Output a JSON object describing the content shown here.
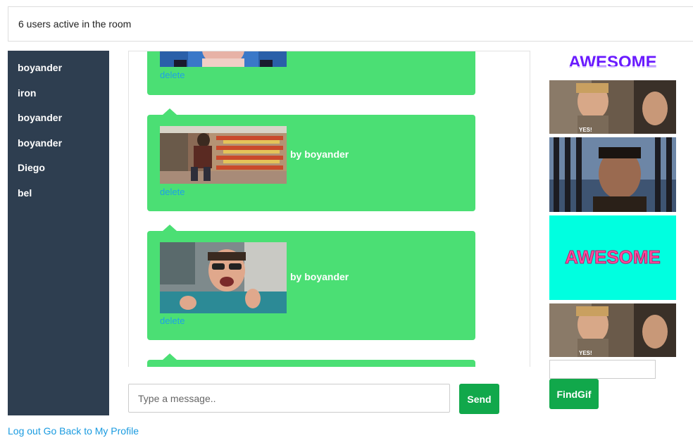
{
  "header": {
    "status_text": "6 users active in the room"
  },
  "sidebar": {
    "users": [
      "boyander",
      "iron",
      "boyander",
      "boyander",
      "Diego",
      "bel"
    ]
  },
  "messages": [
    {
      "author_text": "",
      "delete_label": "delete"
    },
    {
      "author_text": "by boyander",
      "delete_label": "delete"
    },
    {
      "author_text": "by boyander",
      "delete_label": "delete"
    }
  ],
  "composer": {
    "placeholder": "Type a message..",
    "send_label": "Send"
  },
  "gif_panel": {
    "findgif_label": "FindGif",
    "gifs": [
      {
        "icon": "awesome-text-gif",
        "caption": "AWESOME"
      },
      {
        "icon": "yes-man-gif",
        "caption": "YES!"
      },
      {
        "icon": "man-balcony-gif",
        "caption": ""
      },
      {
        "icon": "awesome-cyan-gif",
        "caption": "AWESOME"
      },
      {
        "icon": "yes-man-gif",
        "caption": "YES!"
      }
    ]
  },
  "footer": {
    "logout_label": "Log out",
    "profile_label": "Go Back to My Profile"
  },
  "colors": {
    "sidebar": "#2e3e50",
    "bubble": "#4bdf74",
    "button": "#11a84b",
    "link": "#1ea1e6"
  }
}
